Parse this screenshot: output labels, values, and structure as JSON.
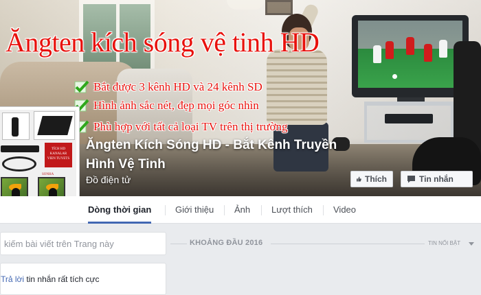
{
  "cover": {
    "headline": "Ăngten kích sóng vệ tinh HD",
    "features": [
      "Bắt được 3 kênh HD và 24 kênh SD",
      "Hình ảnh sắc nét, đẹp mọi góc nhìn",
      "Phù hợp với tất cả loại TV trên thị trường"
    ],
    "accent_color": "#e8110c",
    "check_color": "#2fa81c"
  },
  "profile_picture": {
    "label_lines": [
      "TÍCH HD",
      "KANALAR",
      "VIEN TUYETS"
    ],
    "bottom_label": "SONHA"
  },
  "page": {
    "name": "Ăngten Kích Sóng HD - Bắt Kênh Truyền Hình Vệ Tinh",
    "category": "Đồ điện tử"
  },
  "actions": {
    "like_label": "Thích",
    "message_label": "Tin nhắn"
  },
  "tabs": [
    {
      "label": "Dòng thời gian",
      "active": true
    },
    {
      "label": "Giới thiệu",
      "active": false
    },
    {
      "label": "Ảnh",
      "active": false
    },
    {
      "label": "Lượt thích",
      "active": false
    },
    {
      "label": "Video",
      "active": false
    }
  ],
  "sidebar": {
    "search_placeholder": "kiếm bài viết trên Trang này",
    "reply_link": "Trả lời",
    "reply_text": " tin nhắn rất tích cực"
  },
  "timeline": {
    "section_label": "KHOẢNG ĐẦU 2016",
    "filter_label": "TIN NỔI BẬT"
  },
  "colors": {
    "facebook_blue": "#4267b2",
    "page_bg": "#e9ebee"
  }
}
